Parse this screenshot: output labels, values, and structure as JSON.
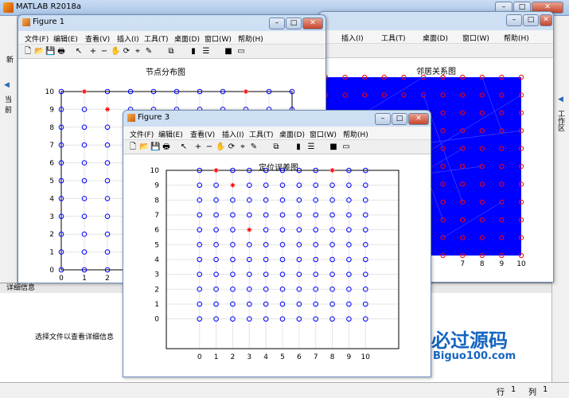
{
  "app": {
    "title": "MATLAB R2018a"
  },
  "detail_panel": {
    "header": "详细信息",
    "message": "选择文件以查看详细信息"
  },
  "status": {
    "row_label": "行",
    "row": "1",
    "col_label": "列",
    "col": "1"
  },
  "side": {
    "current_folder_label": "当前",
    "workspace_label": "工作区",
    "new_label": "新"
  },
  "menu_items": [
    "文件(F)",
    "编辑(E)",
    "查看(V)",
    "插入(I)",
    "工具(T)",
    "桌面(D)",
    "窗口(W)",
    "帮助(H)"
  ],
  "figure1": {
    "title": "Figure 1",
    "plot_title": "节点分布图"
  },
  "figure2": {
    "plot_title": "邻居关系图",
    "menu_items": [
      "插入(I)",
      "工具(T)",
      "桌面(D)",
      "窗口(W)",
      "帮助(H)"
    ]
  },
  "figure3": {
    "title": "Figure 3",
    "plot_title": "定位误差图"
  },
  "watermark": {
    "text": "必过源码",
    "url": "Biguo100.com"
  },
  "colors": {
    "node": "#0000ff",
    "anchor": "#ff0000",
    "edges": "#0000ff",
    "title_bar": "#c5d9f1"
  },
  "chart_data": [
    {
      "type": "scatter",
      "title": "节点分布图",
      "xlim": [
        0,
        10
      ],
      "ylim": [
        0,
        10
      ],
      "x_ticks": [
        0,
        1,
        2
      ],
      "y_ticks": [
        0,
        1,
        2,
        3,
        4,
        5,
        6,
        7,
        8,
        9,
        10
      ],
      "series": [
        {
          "marker": "o",
          "grid": "11x11 points, x 0..10, y 0..10"
        },
        {
          "marker": "*",
          "points": [
            [
              1,
              10
            ],
            [
              2,
              9
            ],
            [
              8,
              10
            ]
          ]
        }
      ]
    },
    {
      "type": "scatter",
      "title": "邻居关系图",
      "xlim": [
        0,
        10
      ],
      "ylim": [
        0,
        10
      ],
      "x_ticks": [
        7,
        8,
        9,
        10
      ],
      "series": [
        {
          "marker": "o+edges",
          "grid": "11x11 points"
        }
      ]
    },
    {
      "type": "scatter",
      "title": "定位误差图",
      "xlim": [
        -2,
        12
      ],
      "ylim": [
        -2,
        10
      ],
      "x_ticks": [
        0,
        1,
        2,
        3,
        4,
        5,
        6,
        7,
        8,
        9,
        10
      ],
      "y_ticks": [
        0,
        1,
        2,
        3,
        4,
        5,
        6,
        7,
        8,
        9,
        10
      ],
      "series": [
        {
          "marker": "o"
        },
        {
          "marker": "*",
          "points": [
            [
              1,
              10
            ],
            [
              2,
              9
            ],
            [
              3,
              6
            ],
            [
              8,
              10
            ]
          ]
        }
      ]
    }
  ]
}
